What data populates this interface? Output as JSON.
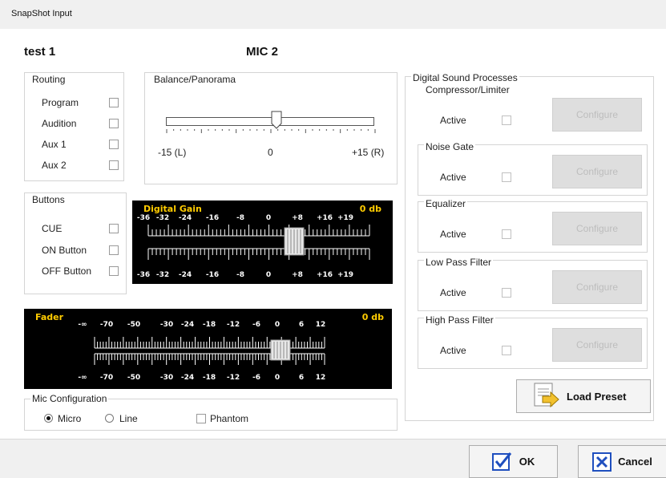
{
  "window": {
    "title": "SnapShot Input"
  },
  "header": {
    "name": "test 1",
    "mic": "MIC 2"
  },
  "routing": {
    "label": "Routing",
    "items": [
      {
        "label": "Program",
        "checked": false
      },
      {
        "label": "Audition",
        "checked": false
      },
      {
        "label": "Aux 1",
        "checked": false
      },
      {
        "label": "Aux 2",
        "checked": false
      }
    ]
  },
  "balance": {
    "label": "Balance/Panorama",
    "left_label": "-15 (L)",
    "center_label": "0",
    "right_label": "+15 (R)",
    "value": 0,
    "min": -15,
    "max": 15
  },
  "buttons": {
    "label": "Buttons",
    "items": [
      {
        "label": "CUE",
        "checked": false
      },
      {
        "label": "ON Button",
        "checked": false
      },
      {
        "label": "OFF Button",
        "checked": false
      }
    ]
  },
  "digital_gain": {
    "label": "Digital Gain",
    "value_text": "0 db",
    "ticks": [
      "-36",
      "-32",
      "-24",
      "-16",
      "-8",
      "0",
      "+8",
      "+16",
      "+19"
    ],
    "value": 0,
    "min": -36,
    "max": 19
  },
  "fader": {
    "label": "Fader",
    "value_text": "0 db",
    "ticks": [
      "-∞",
      "-70",
      "-50",
      "-30",
      "-24",
      "-18",
      "-12",
      "-6",
      "0",
      "6",
      "12"
    ],
    "value": 0
  },
  "mic_config": {
    "label": "Mic Configuration",
    "options": [
      {
        "label": "Micro",
        "selected": true
      },
      {
        "label": "Line",
        "selected": false
      }
    ],
    "phantom_label": "Phantom",
    "phantom_checked": false
  },
  "dsp": {
    "label": "Digital Sound Processes",
    "active_label": "Active",
    "configure_label": "Configure",
    "processes": [
      {
        "name": "Compressor/Limiter",
        "active": false
      },
      {
        "name": "Noise Gate",
        "active": false
      },
      {
        "name": "Equalizer",
        "active": false
      },
      {
        "name": "Low Pass Filter",
        "active": false
      },
      {
        "name": "High Pass Filter",
        "active": false
      }
    ]
  },
  "actions": {
    "load_preset": "Load Preset",
    "ok": "OK",
    "cancel": "Cancel"
  },
  "colors": {
    "meter_bg": "#000000",
    "meter_accent": "#ffcc00",
    "ok_check": "#1f4fbf",
    "cancel_x": "#1f4fbf"
  }
}
